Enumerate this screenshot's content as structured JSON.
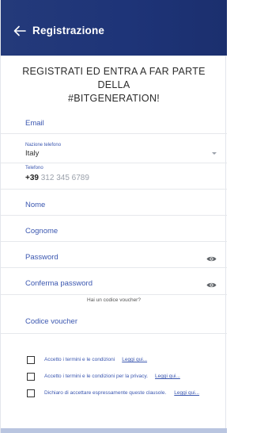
{
  "appbar": {
    "back_icon": "arrow-left-icon",
    "title": "Registrazione",
    "color": "#1f357a"
  },
  "headline": {
    "line1": "REGISTRATI ED ENTRA A FAR PARTE DELLA",
    "line2": "#BITGENERATION!"
  },
  "form": {
    "email": {
      "placeholder": "Email"
    },
    "country": {
      "label": "Nazione telefono",
      "value": "Italy",
      "icon": "chevron-down-icon"
    },
    "phone": {
      "label": "Telefono",
      "prefix": "+39",
      "placeholder": "312 345 6789"
    },
    "first_name": {
      "placeholder": "Nome"
    },
    "last_name": {
      "placeholder": "Cognome"
    },
    "password": {
      "placeholder": "Password",
      "icon": "eye-icon"
    },
    "confirm_password": {
      "placeholder": "Conferma password",
      "icon": "eye-icon"
    },
    "voucher_hint": "Hai un codice voucher?",
    "voucher": {
      "placeholder": "Codice voucher"
    }
  },
  "consents": [
    {
      "text": "Accetto i termini e le condizioni",
      "link": "Leggi qui..."
    },
    {
      "text": "Accetto i termini e le condizioni per la privacy.",
      "link": "Leggi qui..."
    },
    {
      "text": "Dichiaro di accettare espressamente queste clausole.",
      "link": "Leggi qui..."
    }
  ],
  "colors": {
    "accent": "#3b57b0",
    "divider": "#e6e8ec"
  }
}
